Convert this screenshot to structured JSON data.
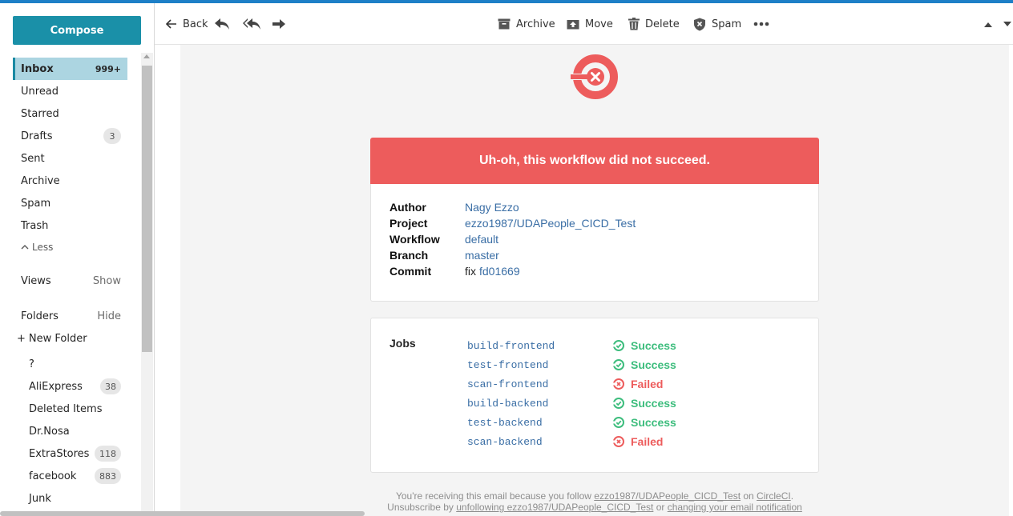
{
  "sidebar": {
    "compose_label": "Compose",
    "nav": [
      {
        "label": "Inbox",
        "count": "999+",
        "active": true
      },
      {
        "label": "Unread",
        "count": ""
      },
      {
        "label": "Starred",
        "count": ""
      },
      {
        "label": "Drafts",
        "count": "3"
      },
      {
        "label": "Sent",
        "count": ""
      },
      {
        "label": "Archive",
        "count": ""
      },
      {
        "label": "Spam",
        "count": ""
      },
      {
        "label": "Trash",
        "count": ""
      }
    ],
    "less_label": "Less",
    "views_label": "Views",
    "views_action": "Show",
    "folders_label": "Folders",
    "folders_action": "Hide",
    "new_folder_label": "New Folder",
    "folders": [
      {
        "label": "?",
        "count": ""
      },
      {
        "label": "AliExpress",
        "count": "38"
      },
      {
        "label": "Deleted Items",
        "count": ""
      },
      {
        "label": "Dr.Nosa",
        "count": ""
      },
      {
        "label": "ExtraStores",
        "count": "118"
      },
      {
        "label": "facebook",
        "count": "883"
      },
      {
        "label": "Junk",
        "count": ""
      }
    ]
  },
  "toolbar": {
    "back_label": "Back",
    "archive_label": "Archive",
    "move_label": "Move",
    "delete_label": "Delete",
    "spam_label": "Spam"
  },
  "email": {
    "banner": "Uh-oh, this workflow did not succeed.",
    "details": [
      {
        "label": "Author",
        "value": "Nagy Ezzo"
      },
      {
        "label": "Project",
        "value": "ezzo1987/UDAPeople_CICD_Test"
      },
      {
        "label": "Workflow",
        "value": "default"
      },
      {
        "label": "Branch",
        "value": "master"
      },
      {
        "label": "Commit",
        "prefix": "fix",
        "value": "fd01669"
      }
    ],
    "jobs_title": "Jobs",
    "jobs": [
      {
        "name": "build-frontend",
        "status": "Success"
      },
      {
        "name": "test-frontend",
        "status": "Success"
      },
      {
        "name": "scan-frontend",
        "status": "Failed"
      },
      {
        "name": "build-backend",
        "status": "Success"
      },
      {
        "name": "test-backend",
        "status": "Success"
      },
      {
        "name": "scan-backend",
        "status": "Failed"
      }
    ],
    "footer": {
      "line1_prefix": "You're receiving this email because you follow ",
      "line1_link": "ezzo1987/UDAPeople_CICD_Test",
      "line1_mid": " on ",
      "line1_link2": "CircleCI",
      "line1_suffix": ".",
      "line2_prefix": "Unsubscribe by ",
      "line2_link": "unfollowing ezzo1987/UDAPeople_CICD_Test",
      "line2_mid": " or ",
      "line2_link2": "changing your email notification"
    },
    "colors": {
      "failure": "#ed5c5c",
      "success": "#3dbd7d",
      "link": "#3a6ea5",
      "compose": "#1a90a8"
    }
  }
}
